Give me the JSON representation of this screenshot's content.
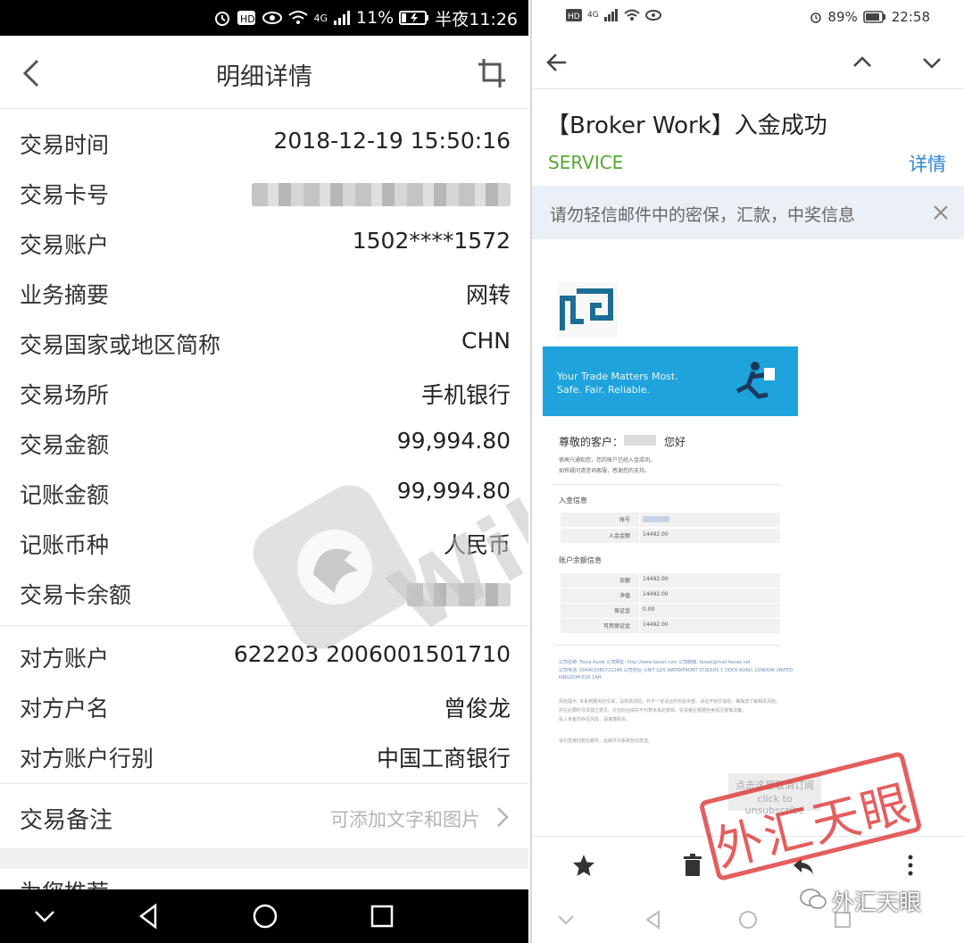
{
  "left": {
    "status": {
      "net": "4G",
      "battery": "11%",
      "time": "半夜11:26"
    },
    "header": {
      "title": "明细详情"
    },
    "rows": [
      {
        "label": "交易时间",
        "value": "2018-12-19 15:50:16"
      },
      {
        "label": "交易卡号",
        "value": ""
      },
      {
        "label": "交易账户",
        "value": "1502****1572"
      },
      {
        "label": "业务摘要",
        "value": "网转"
      },
      {
        "label": "交易国家或地区简称",
        "value": "CHN"
      },
      {
        "label": "交易场所",
        "value": "手机银行"
      },
      {
        "label": "交易金额",
        "value": "99,994.80"
      },
      {
        "label": "记账金额",
        "value": "99,994.80"
      },
      {
        "label": "记账币种",
        "value": "人民币"
      },
      {
        "label": "交易卡余额",
        "value": ""
      }
    ],
    "counterparty": [
      {
        "label": "对方账户",
        "value": "622203 2006001501710"
      },
      {
        "label": "对方户名",
        "value": "曾俊龙"
      },
      {
        "label": "对方账户行别",
        "value": "中国工商银行"
      }
    ],
    "note": {
      "label": "交易备注",
      "placeholder": "可添加文字和图片"
    },
    "peek": "为您推荐",
    "watermark": "WikiFX"
  },
  "right": {
    "status": {
      "net": "4G",
      "battery": "89%",
      "time": "22:58"
    },
    "subject": "【Broker Work】入金成功",
    "sender": "SERVICE",
    "detail_link": "详情",
    "warning": "请勿轻信邮件中的密保，汇款，中奖信息",
    "banner": {
      "line1": "Your Trade Matters Most.",
      "line2": "Safe. Fair. Reliable."
    },
    "greeting": {
      "prefix": "尊敬的客户：",
      "suffix": "您好"
    },
    "intro": [
      "很高兴通知您，您的账户已经入金成功。",
      "如有疑问请咨询客服，感谢您的支持。"
    ],
    "deposit": {
      "title": "入金信息",
      "rows": [
        {
          "k": "账号",
          "v": ""
        },
        {
          "k": "入金金额",
          "v": "14492.00"
        }
      ]
    },
    "balance": {
      "title": "账户余额信息",
      "rows": [
        {
          "k": "余额",
          "v": "14492.00"
        },
        {
          "k": "净值",
          "v": "14492.00"
        },
        {
          "k": "保证金",
          "v": "0.00"
        },
        {
          "k": "可用保证金",
          "v": "14492.00"
        }
      ]
    },
    "footer": {
      "line1": "公司名称: Fiona Asset  公司网址: http://www.fasset.com  公司邮箱: fasset@mail.fasset.net",
      "line2": "公司电话: 004402080722246  公司地址: UNIT G25 WATERFRONT STUDIOS 1 DOCK ROAD, LONDON UNITED",
      "line3": "KINGDOM E16 1AH",
      "risk1": "风险提示: 本系统服务的交易，具有高风险，并不一定适合所有投资者。请在开始交易前，确保您了解相关风险，",
      "risk2": "并在必要时寻求独立意见。过往的业绩并不代表未来的表现。投资者应根据自身情况谨慎决策。",
      "risk3": "投入资金均存在风险，请谨慎投资。",
      "auto": "请勿直接回复此邮件，此邮件为系统自动发送。"
    },
    "unsubscribe": {
      "line1": "点击这里取消订阅",
      "line2": "click to unsubscribe"
    },
    "stamp": "外汇天眼",
    "brand": "外汇天眼"
  }
}
